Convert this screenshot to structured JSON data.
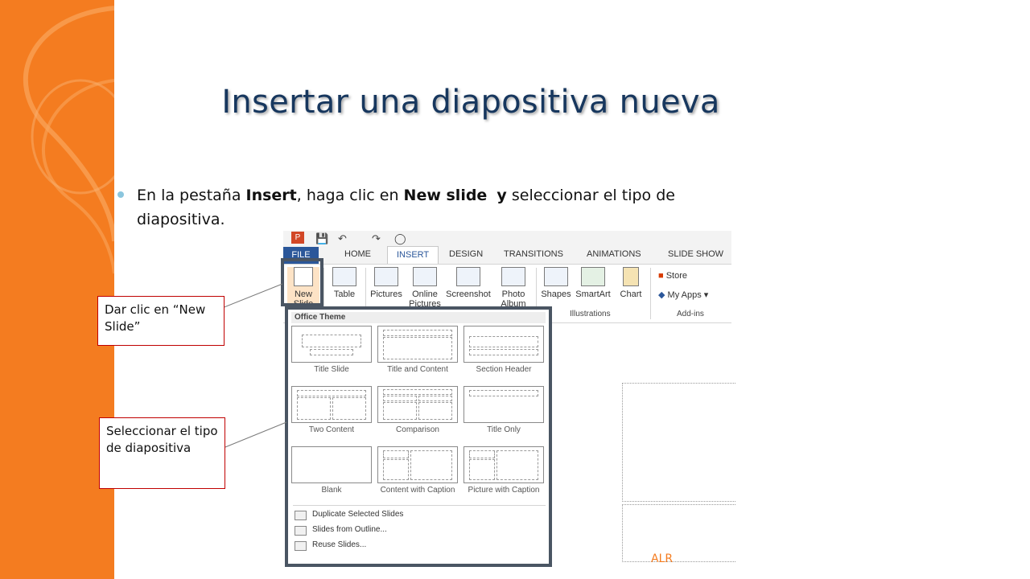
{
  "slide": {
    "title": "Insertar una diapositiva nueva",
    "bullet": {
      "t1": "En la pestaña ",
      "b1": "Insert",
      "t2": ", haga clic en ",
      "b2": "New slide",
      "t3": "  ",
      "b3": "y",
      "t4": " seleccionar el tipo de diapositiva."
    },
    "footer": "ALR",
    "accent": "#f47c20",
    "title_color": "#17375e"
  },
  "callouts": {
    "new_slide": "Dar clic en “New Slide”",
    "select_type": "Seleccionar el tipo de diapositiva"
  },
  "ribbon": {
    "tabs": [
      "FILE",
      "HOME",
      "INSERT",
      "DESIGN",
      "TRANSITIONS",
      "ANIMATIONS",
      "SLIDE SHOW"
    ],
    "active_tab": "INSERT",
    "buttons": {
      "new_slide": "New Slide",
      "table": "Table",
      "pictures": "Pictures",
      "online_pictures": "Online Pictures",
      "screenshot": "Screenshot",
      "photo_album": "Photo Album",
      "shapes": "Shapes",
      "smartart": "SmartArt",
      "chart": "Chart",
      "store": "Store",
      "my_apps": "My Apps"
    },
    "groups": {
      "illustrations": "Illustrations",
      "addins": "Add-ins"
    }
  },
  "dropdown": {
    "header": "Office Theme",
    "layouts": [
      "Title Slide",
      "Title and Content",
      "Section Header",
      "Two Content",
      "Comparison",
      "Title Only",
      "Blank",
      "Content with Caption",
      "Picture with Caption"
    ],
    "menu": [
      "Duplicate Selected Slides",
      "Slides from Outline...",
      "Reuse Slides..."
    ]
  }
}
